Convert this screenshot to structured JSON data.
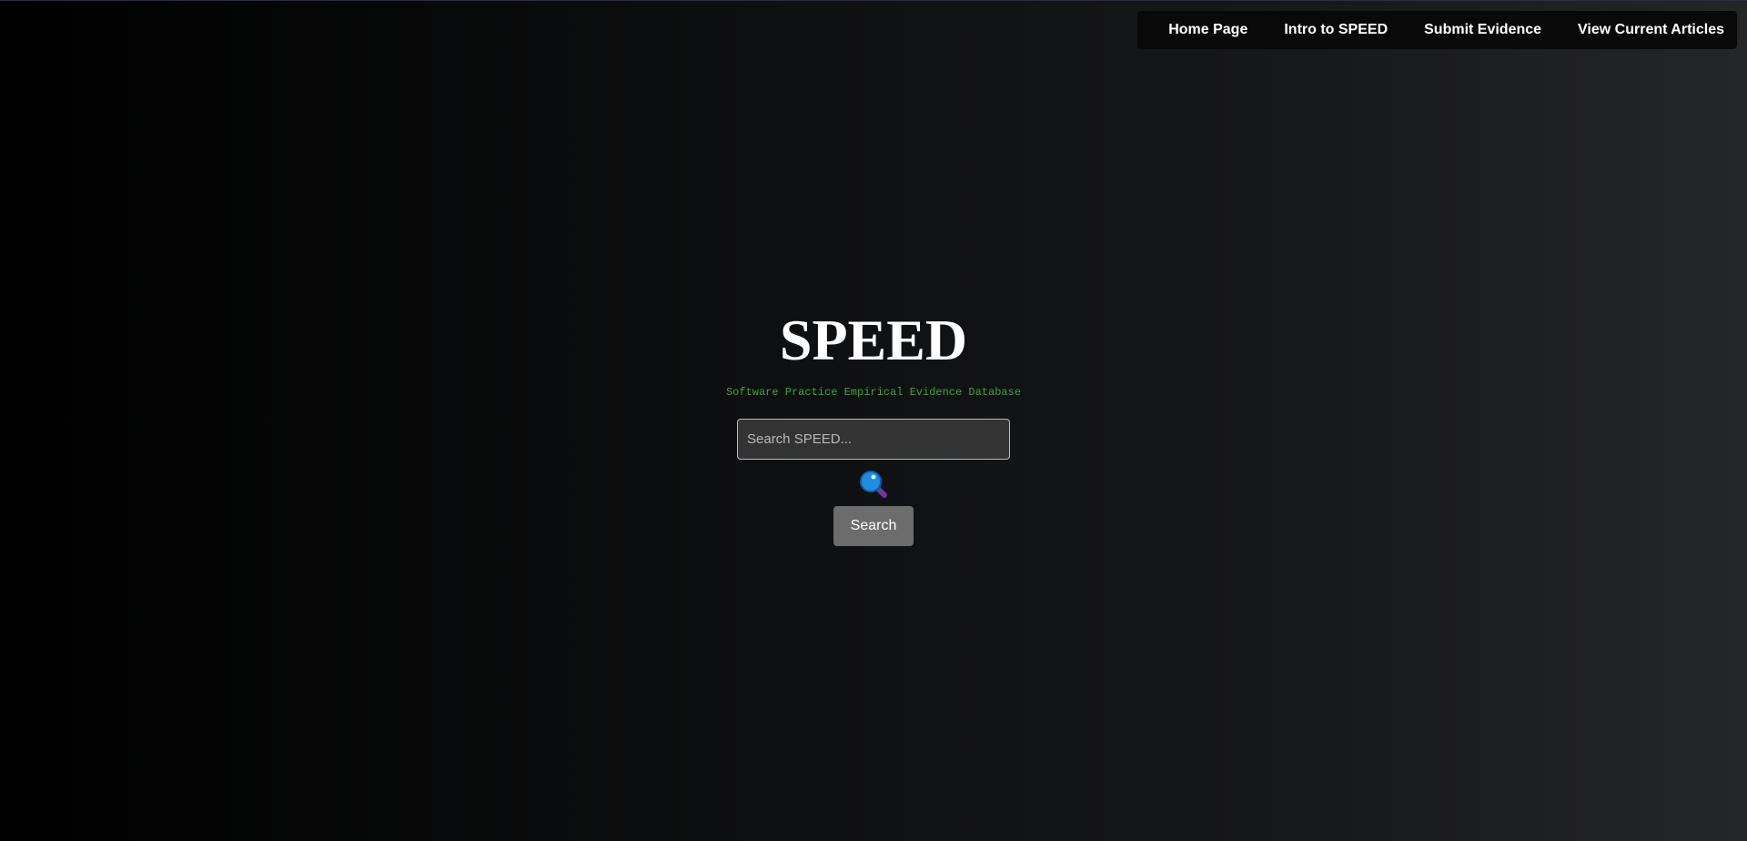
{
  "nav": {
    "items": [
      {
        "label": "Home Page"
      },
      {
        "label": "Intro to SPEED"
      },
      {
        "label": "Submit Evidence"
      },
      {
        "label": "View Current Articles"
      }
    ]
  },
  "hero": {
    "title": "SPEED",
    "subtitle": "Software Practice Empirical Evidence Database"
  },
  "search": {
    "placeholder": "Search SPEED...",
    "value": "",
    "icon": "magnifying-glass-icon",
    "button_label": "Search"
  },
  "colors": {
    "subtitle": "#3fa33f",
    "button": "#6c6c6c",
    "input_bg": "#333333",
    "nav_bg": "#090909"
  }
}
